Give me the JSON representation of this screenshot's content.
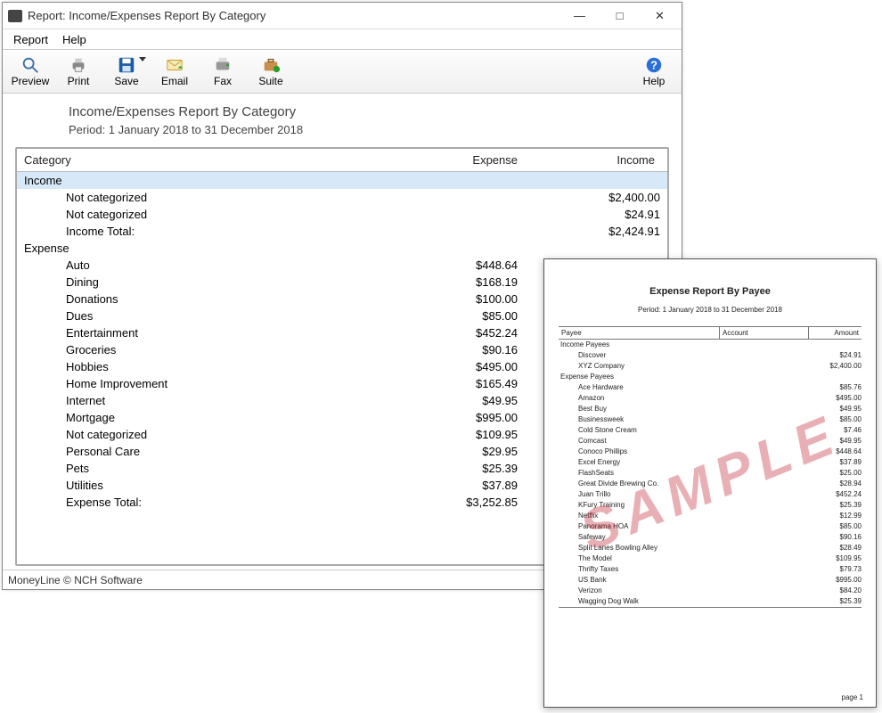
{
  "window": {
    "title": "Report: Income/Expenses Report By Category"
  },
  "menu": {
    "report": "Report",
    "help": "Help"
  },
  "toolbar": {
    "preview": "Preview",
    "print": "Print",
    "save": "Save",
    "email": "Email",
    "fax": "Fax",
    "suite": "Suite",
    "help": "Help"
  },
  "report": {
    "title": "Income/Expenses Report By Category",
    "period": "Period: 1 January 2018 to 31 December 2018",
    "headers": {
      "category": "Category",
      "expense": "Expense",
      "income": "Income"
    },
    "income_section": "Income",
    "income_rows": [
      {
        "label": "Not categorized",
        "income": "$2,400.00"
      },
      {
        "label": "Not categorized",
        "income": "$24.91"
      },
      {
        "label": "Income Total:",
        "income": "$2,424.91"
      }
    ],
    "expense_section": "Expense",
    "expense_rows": [
      {
        "label": "Auto",
        "expense": "$448.64"
      },
      {
        "label": "Dining",
        "expense": "$168.19"
      },
      {
        "label": "Donations",
        "expense": "$100.00"
      },
      {
        "label": "Dues",
        "expense": "$85.00"
      },
      {
        "label": "Entertainment",
        "expense": "$452.24"
      },
      {
        "label": "Groceries",
        "expense": "$90.16"
      },
      {
        "label": "Hobbies",
        "expense": "$495.00"
      },
      {
        "label": "Home Improvement",
        "expense": "$165.49"
      },
      {
        "label": "Internet",
        "expense": "$49.95"
      },
      {
        "label": "Mortgage",
        "expense": "$995.00"
      },
      {
        "label": "Not categorized",
        "expense": "$109.95"
      },
      {
        "label": "Personal Care",
        "expense": "$29.95"
      },
      {
        "label": "Pets",
        "expense": "$25.39"
      },
      {
        "label": "Utilities",
        "expense": "$37.89"
      },
      {
        "label": "Expense Total:",
        "expense": "$3,252.85"
      }
    ]
  },
  "status": {
    "text": "MoneyLine © NCH Software"
  },
  "sample": {
    "watermark": "SAMPLE",
    "title": "Expense Report By Payee",
    "period": "Period: 1 January 2018 to 31 December 2018",
    "headers": {
      "payee": "Payee",
      "account": "Account",
      "amount": "Amount"
    },
    "income_section": "Income Payees",
    "income_rows": [
      {
        "payee": "Discover",
        "amount": "$24.91"
      },
      {
        "payee": "XYZ Company",
        "amount": "$2,400.00"
      }
    ],
    "expense_section": "Expense Payees",
    "expense_rows": [
      {
        "payee": "Ace Hardware",
        "amount": "$85.76"
      },
      {
        "payee": "Amazon",
        "amount": "$495.00"
      },
      {
        "payee": "Best Buy",
        "amount": "$49.95"
      },
      {
        "payee": "Businessweek",
        "amount": "$85.00"
      },
      {
        "payee": "Cold Stone Cream",
        "amount": "$7.46"
      },
      {
        "payee": "Comcast",
        "amount": "$49.95"
      },
      {
        "payee": "Conoco Phillips",
        "amount": "$448.64"
      },
      {
        "payee": "Excel Energy",
        "amount": "$37.89"
      },
      {
        "payee": "FlashSeats",
        "amount": "$25.00"
      },
      {
        "payee": "Great Divide Brewing Co.",
        "amount": "$28.94"
      },
      {
        "payee": "Juan Trillo",
        "amount": "$452.24"
      },
      {
        "payee": "KFury Training",
        "amount": "$25.39"
      },
      {
        "payee": "Netflix",
        "amount": "$12.99"
      },
      {
        "payee": "Panorama HOA",
        "amount": "$85.00"
      },
      {
        "payee": "Safeway",
        "amount": "$90.16"
      },
      {
        "payee": "Split Lanes Bowling Alley",
        "amount": "$28.49"
      },
      {
        "payee": "The Model",
        "amount": "$109.95"
      },
      {
        "payee": "Thrifty Taxes",
        "amount": "$79.73"
      },
      {
        "payee": "US Bank",
        "amount": "$995.00"
      },
      {
        "payee": "Verizon",
        "amount": "$84.20"
      },
      {
        "payee": "Wagging Dog Walk",
        "amount": "$25.39"
      }
    ],
    "page": "page 1"
  }
}
